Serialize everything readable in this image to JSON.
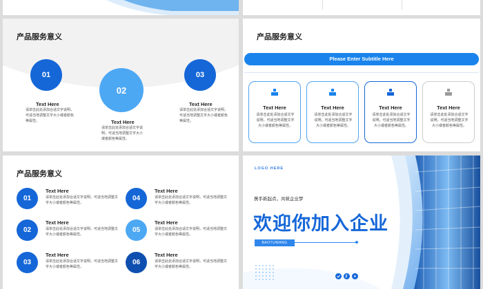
{
  "colors": {
    "primary": "#1567d8",
    "light": "#4da8f4",
    "dark": "#0e4fb0",
    "grey": "#9a9a9a"
  },
  "top_left": {},
  "top_right": {},
  "slide_a": {
    "title": "产品服务意义",
    "items": [
      {
        "num": "01",
        "heading": "Text Here",
        "desc": "请单击此处添加合适文字说明，可适当地调整文字大小或者颜色等属性。"
      },
      {
        "num": "02",
        "heading": "Text Here",
        "desc": "请单击此处添加合适文字说明，可适当地调整文字大小或者颜色等属性。"
      },
      {
        "num": "03",
        "heading": "Text Here",
        "desc": "请单击此处添加合适文字说明，可适当地调整文字大小或者颜色等属性。"
      }
    ]
  },
  "slide_b": {
    "title": "产品服务意义",
    "subtitle": "Please Enter Subtitle Here",
    "cards": [
      {
        "icon": "podium-icon",
        "heading": "Text Here",
        "desc": "请单击此处添加合适文字说明，可适当地调整文字大小或者颜色等属性。"
      },
      {
        "icon": "podium-icon",
        "heading": "Text Here",
        "desc": "请单击此处添加合适文字说明，可适当地调整文字大小或者颜色等属性。"
      },
      {
        "icon": "podium-icon",
        "heading": "Text Here",
        "desc": "请单击此处添加合适文字说明，可适当地调整文字大小或者颜色等属性。"
      },
      {
        "icon": "podium-icon",
        "heading": "Text Here",
        "desc": "请单击此处添加合适文字说明，可适当地调整文字大小或者颜色等属性。"
      }
    ]
  },
  "slide_c": {
    "title": "产品服务意义",
    "items": [
      {
        "num": "01",
        "heading": "Text Here",
        "desc": "请单击此处添加合适文字说明，可适当地调整文字大小或者颜色等属性。"
      },
      {
        "num": "02",
        "heading": "Text Here",
        "desc": "请单击此处添加合适文字说明，可适当地调整文字大小或者颜色等属性。"
      },
      {
        "num": "03",
        "heading": "Text Here",
        "desc": "请单击此处添加合适文字说明，可适当地调整文字大小或者颜色等属性。"
      },
      {
        "num": "04",
        "heading": "Text Here",
        "desc": "请单击此处添加合适文字说明，可适当地调整文字大小或者颜色等属性。"
      },
      {
        "num": "05",
        "heading": "Text Here",
        "desc": "请单击此处添加合适文字说明，可适当地调整文字大小或者颜色等属性。"
      },
      {
        "num": "06",
        "heading": "Text Here",
        "desc": "请单击此处添加合适文字说明，可适当地调整文字大小或者颜色等属性。"
      }
    ]
  },
  "slide_d": {
    "logo": "LOGO HERE",
    "tagline": "携手新起点，共筑企业梦",
    "headline": "欢迎你加入企业",
    "badge": "BAOTUWANG",
    "social": [
      "weibo-icon",
      "facebook-icon",
      "play-icon"
    ]
  }
}
